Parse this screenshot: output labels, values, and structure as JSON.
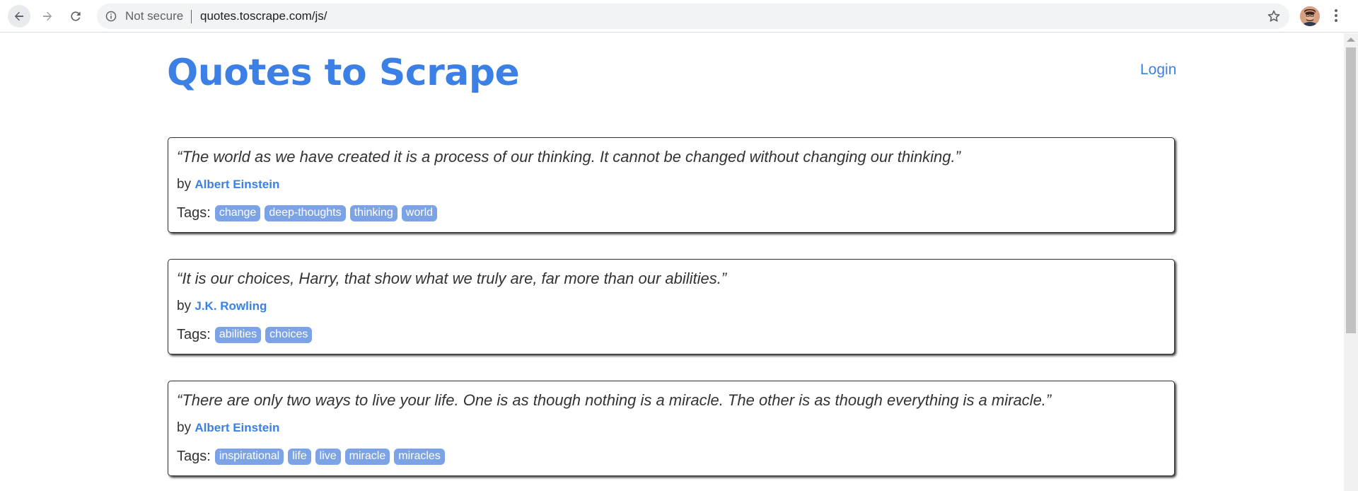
{
  "browser": {
    "security_label": "Not secure",
    "url": "quotes.toscrape.com/js/"
  },
  "header": {
    "title": "Quotes to Scrape",
    "login": "Login"
  },
  "labels": {
    "by": "by",
    "tags": "Tags:"
  },
  "quotes": [
    {
      "text": "“The world as we have created it is a process of our thinking. It cannot be changed without changing our thinking.”",
      "author": "Albert Einstein",
      "tags": [
        "change",
        "deep-thoughts",
        "thinking",
        "world"
      ]
    },
    {
      "text": "“It is our choices, Harry, that show what we truly are, far more than our abilities.”",
      "author": "J.K. Rowling",
      "tags": [
        "abilities",
        "choices"
      ]
    },
    {
      "text": "“There are only two ways to live your life. One is as though nothing is a miracle. The other is as though everything is a miracle.”",
      "author": "Albert Einstein",
      "tags": [
        "inspirational",
        "life",
        "live",
        "miracle",
        "miracles"
      ]
    }
  ],
  "colors": {
    "accent": "#3c80e5",
    "tag_bg": "#7ca3e6"
  }
}
